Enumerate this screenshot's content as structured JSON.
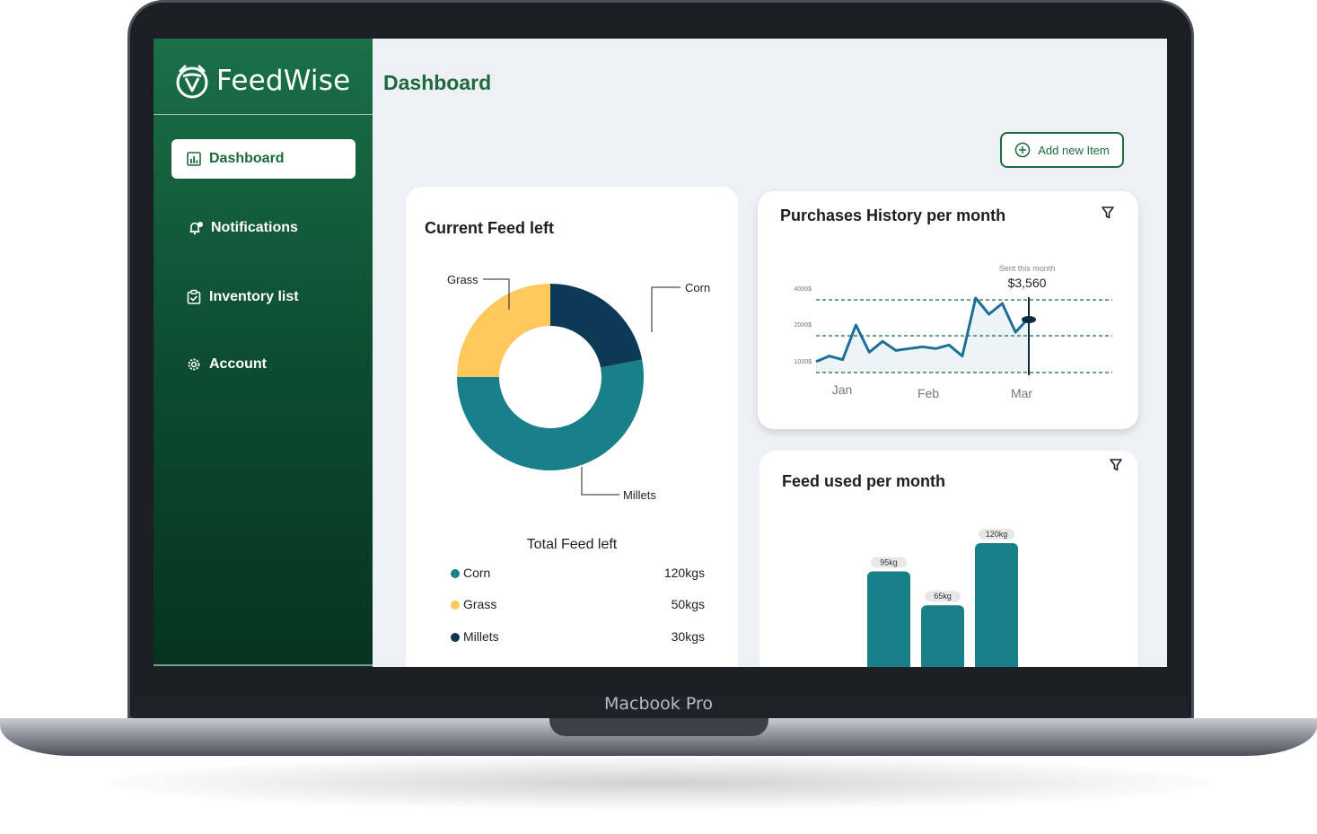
{
  "app": {
    "brand": "FeedWise",
    "device_label": "Macbook Pro"
  },
  "sidebar": {
    "items": [
      {
        "label": "Dashboard",
        "icon": "bar-chart-icon",
        "active": true
      },
      {
        "label": "Notifications",
        "icon": "bell-icon",
        "active": false
      },
      {
        "label": "Inventory list",
        "icon": "clipboard-check-icon",
        "active": false
      },
      {
        "label": "Account",
        "icon": "gear-icon",
        "active": false
      }
    ]
  },
  "header": {
    "title": "Dashboard",
    "add_button_label": "Add new Item"
  },
  "feed_left": {
    "title": "Current Feed left",
    "total_label": "Total Feed left",
    "items": [
      {
        "name": "Corn",
        "amount": "120kgs",
        "color": "#197f89"
      },
      {
        "name": "Grass",
        "amount": "50kgs",
        "color": "#fec85a"
      },
      {
        "name": "Millets",
        "amount": "30kgs",
        "color": "#0c3a56"
      }
    ]
  },
  "purchases": {
    "title": "Purchases History per month",
    "spent_label": "Sent this month",
    "spent_value": "$3,560"
  },
  "feed_used": {
    "title": "Feed used per month"
  },
  "chart_data": [
    {
      "type": "pie",
      "title": "Current Feed left",
      "labels": [
        "Grass",
        "Corn",
        "Millets"
      ],
      "values": [
        25,
        22,
        53
      ],
      "colors": [
        "#fec85a",
        "#0c3a56",
        "#197f89"
      ]
    },
    {
      "type": "line",
      "title": "Purchases History per month",
      "categories": [
        "Jan",
        "Feb",
        "Mar"
      ],
      "y_ticks": [
        "4000$",
        "2000$",
        "1000$"
      ],
      "y_tick_values": [
        4000,
        2000,
        1000
      ],
      "annotation": {
        "label": "Sent this month",
        "value": "$3,560"
      },
      "series": [
        {
          "values": [
            1300,
            1450,
            1350,
            2600,
            1550,
            1850,
            1600,
            1650,
            1700,
            1650,
            1750,
            1450,
            4100,
            3200,
            3800,
            2200,
            3000
          ]
        }
      ],
      "ylim": [
        1000,
        4000
      ]
    },
    {
      "type": "bar",
      "title": "Feed used per month",
      "categories": [
        "Jan",
        "Feb",
        "Mar"
      ],
      "values": [
        95,
        65,
        120
      ],
      "data_labels": [
        "95kg",
        "65kg",
        "120kg"
      ],
      "color": "#197f89"
    }
  ]
}
